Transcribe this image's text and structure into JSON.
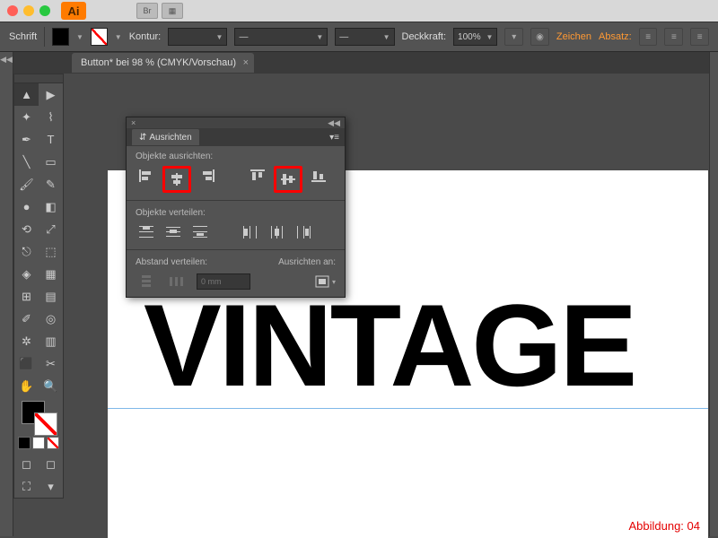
{
  "titlebar": {
    "br_label": "Br"
  },
  "ctrlbar": {
    "schrift": "Schrift",
    "kontur": "Kontur:",
    "deckkraft": "Deckkraft:",
    "deckkraft_val": "100%",
    "zeichen": "Zeichen",
    "absatz": "Absatz:"
  },
  "document": {
    "tab": "Button* bei 98 % (CMYK/Vorschau)"
  },
  "canvas": {
    "text": "VINTAGE",
    "caption": "Abbildung: 04"
  },
  "panel": {
    "title": "Ausrichten",
    "sec1": "Objekte ausrichten:",
    "sec2": "Objekte verteilen:",
    "sec3": "Abstand verteilen:",
    "sec4": "Ausrichten an:",
    "dist_val": "0 mm"
  },
  "icons": {
    "ai": "Ai"
  }
}
